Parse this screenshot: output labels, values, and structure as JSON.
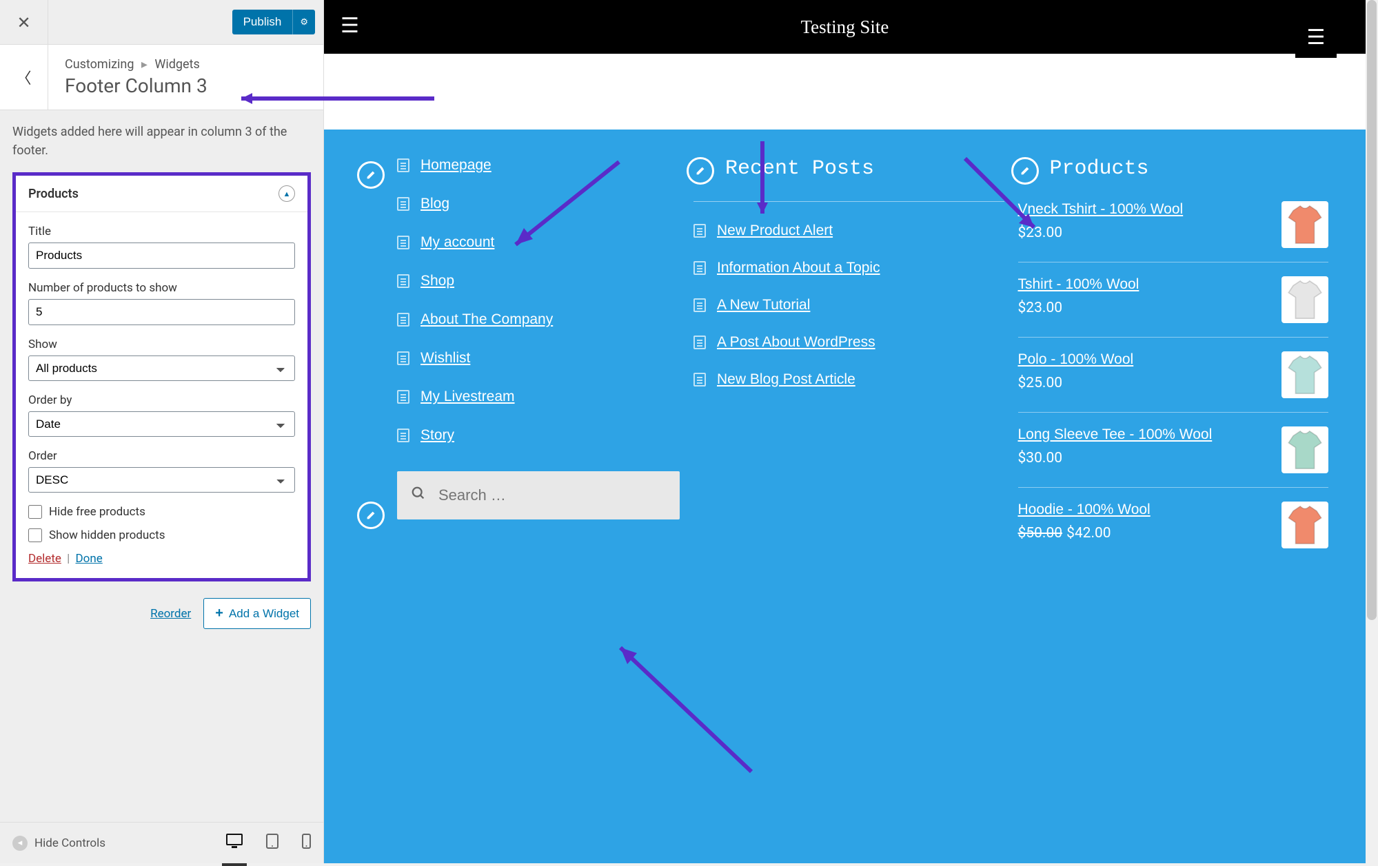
{
  "customizer": {
    "publish_label": "Publish",
    "breadcrumb_root": "Customizing",
    "breadcrumb_section": "Widgets",
    "breadcrumb_title": "Footer Column 3",
    "description": "Widgets added here will appear in column 3 of the footer.",
    "widget": {
      "header": "Products",
      "title_label": "Title",
      "title_value": "Products",
      "num_label": "Number of products to show",
      "num_value": "5",
      "show_label": "Show",
      "show_value": "All products",
      "orderby_label": "Order by",
      "orderby_value": "Date",
      "order_label": "Order",
      "order_value": "DESC",
      "hide_free_label": "Hide free products",
      "show_hidden_label": "Show hidden products",
      "delete_label": "Delete",
      "done_label": "Done"
    },
    "reorder_label": "Reorder",
    "add_widget_label": "Add a Widget",
    "hide_controls_label": "Hide Controls"
  },
  "site": {
    "title": "Testing Site"
  },
  "footer": {
    "col2_title": "Recent Posts",
    "col3_title": "Products",
    "nav_links": [
      "Homepage",
      "Blog",
      "My account",
      "Shop",
      "About The Company",
      "Wishlist",
      "My Livestream",
      "Story"
    ],
    "recent_posts": [
      "New Product Alert",
      "Information About a Topic",
      "A New Tutorial",
      "A Post About WordPress",
      "New Blog Post Article"
    ],
    "products": [
      {
        "name": "Vneck Tshirt - 100% Wool",
        "price": "$23.00",
        "color": "#f08a6c"
      },
      {
        "name": "Tshirt - 100% Wool",
        "price": "$23.00",
        "color": "#e6e6e6"
      },
      {
        "name": "Polo - 100% Wool",
        "price": "$25.00",
        "color": "#b6e0db"
      },
      {
        "name": "Long Sleeve Tee - 100% Wool",
        "price": "$30.00",
        "color": "#a8d8c8"
      },
      {
        "name": "Hoodie - 100% Wool",
        "price": "$42.00",
        "old_price": "$50.00",
        "color": "#f08a6c"
      }
    ],
    "search_placeholder": "Search …"
  }
}
